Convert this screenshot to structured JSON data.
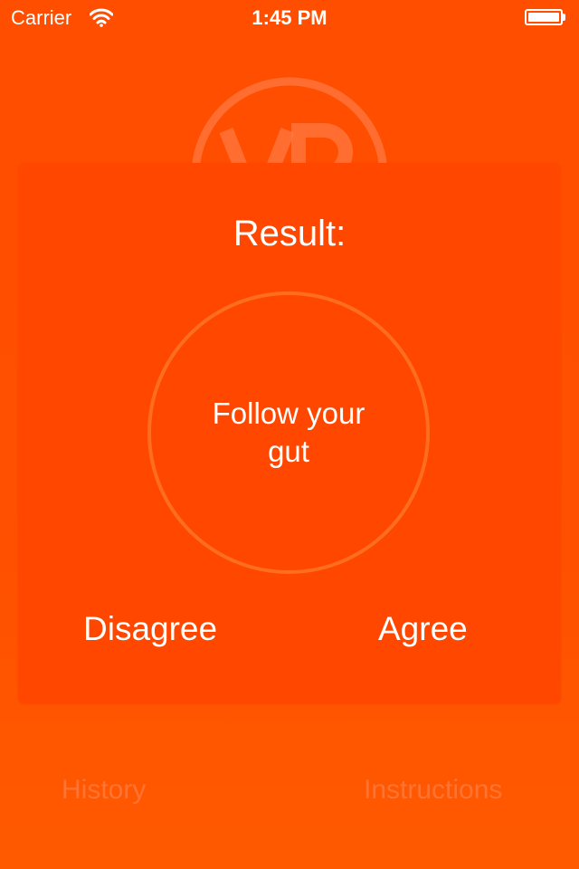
{
  "status_bar": {
    "carrier": "Carrier",
    "time": "1:45 PM",
    "wifi_icon": "wifi-icon",
    "battery_icon": "battery-icon"
  },
  "logo": {
    "text": "VP",
    "icon": "vp-logo"
  },
  "result_card": {
    "title": "Result:",
    "message": "Follow your gut",
    "disagree_label": "Disagree",
    "agree_label": "Agree"
  },
  "bottom_nav": {
    "history_label": "History",
    "instructions_label": "Instructions"
  },
  "colors": {
    "background": "#ff4e00",
    "card": "#ff4700",
    "circle_stroke": "#ff6e1f",
    "faded_text": "#ff7433",
    "text": "#ffffff"
  }
}
